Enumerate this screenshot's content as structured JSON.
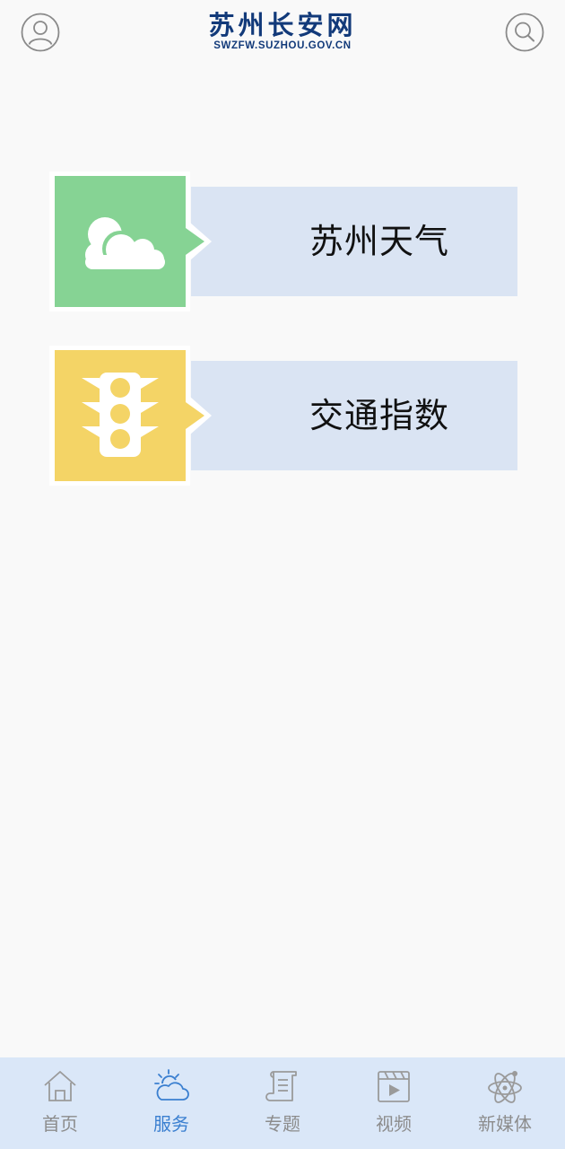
{
  "header": {
    "logo_cn": "苏州长安网",
    "logo_en": "SWZFW.SUZHOU.GOV.CN",
    "user_icon": "user-circle-icon",
    "search_icon": "search-icon"
  },
  "services": [
    {
      "label": "苏州天气",
      "icon": "weather-cloud-icon",
      "color": "#86d394"
    },
    {
      "label": "交通指数",
      "icon": "traffic-light-icon",
      "color": "#f4d466"
    }
  ],
  "tabs": [
    {
      "label": "首页",
      "icon": "home-icon",
      "active": false
    },
    {
      "label": "服务",
      "icon": "sun-cloud-icon",
      "active": true
    },
    {
      "label": "专题",
      "icon": "scroll-icon",
      "active": false
    },
    {
      "label": "视频",
      "icon": "video-clapper-icon",
      "active": false
    },
    {
      "label": "新媒体",
      "icon": "atom-icon",
      "active": false
    }
  ],
  "colors": {
    "accent": "#3a7fd0",
    "bar": "#dae4f3",
    "tabbar": "#dae7f8",
    "logo": "#123a7a"
  }
}
